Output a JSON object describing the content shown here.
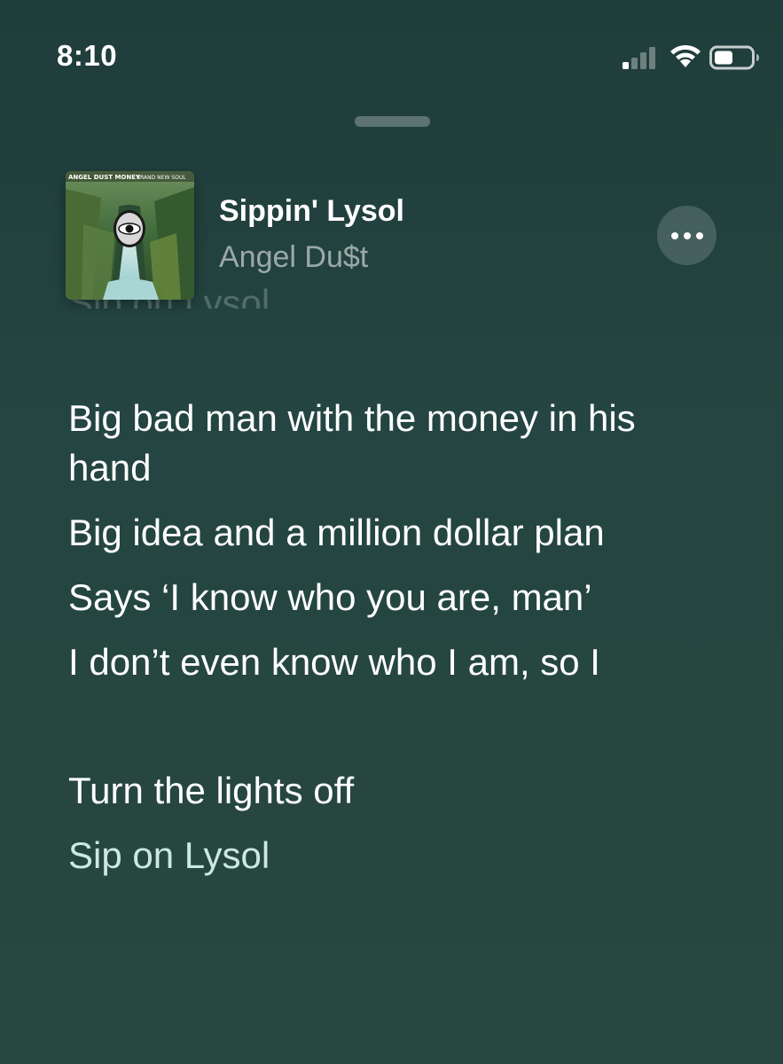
{
  "status_bar": {
    "time": "8:10"
  },
  "now_playing": {
    "title": "Sippin' Lysol",
    "artist": "Angel Du$t",
    "album_art_text": "ANGEL DUST MONEY BRAND NEW SOUL"
  },
  "lyrics": {
    "previous_line": "Sip on Lysol",
    "lines": [
      "Big bad man with the money in his hand",
      "Big idea and a million dollar plan",
      "Says ‘I know who you are, man’",
      "I don’t even know who I am, so I",
      "Turn the lights off",
      "Sip on Lysol"
    ]
  },
  "icons": {
    "signal": "cellular-signal-icon",
    "wifi": "wifi-icon",
    "battery": "battery-icon",
    "more": "more-options-icon"
  },
  "colors": {
    "background": "#244541",
    "lyric_active": "#ffffff",
    "lyric_upcoming": "#cde8e4"
  }
}
